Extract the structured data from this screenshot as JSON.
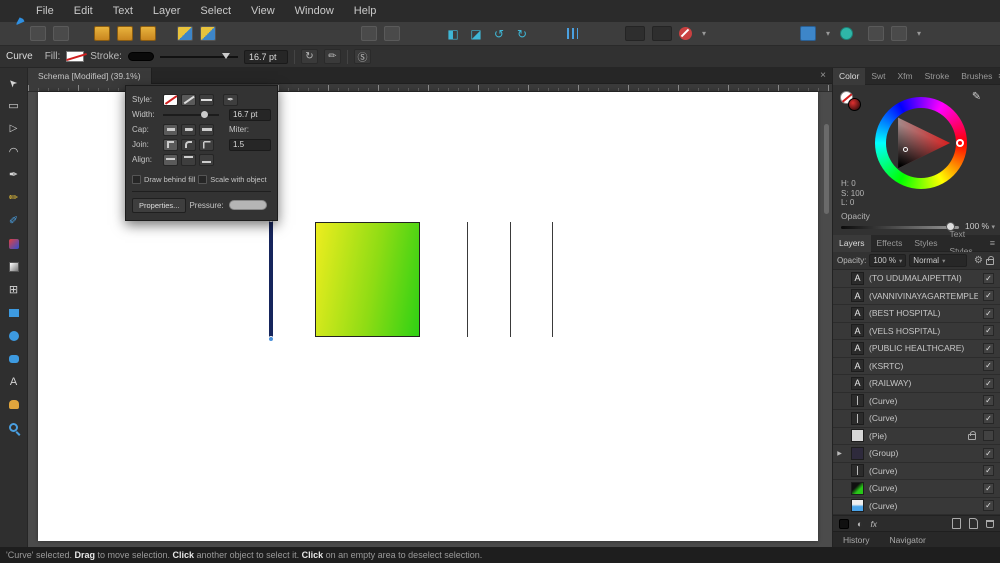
{
  "colors": {
    "accent_blue": "#2f8fe0",
    "canvas_bg": "#4b4b4b",
    "panel_bg": "#323232",
    "gradient_rect_start": "#eded1f",
    "gradient_rect_end": "#2fd114",
    "navy_line": "#16255c",
    "selection_handle": "#4a90d9",
    "snap_off_red": "#c94040"
  },
  "menu": {
    "items": [
      "File",
      "Edit",
      "Text",
      "Layer",
      "Select",
      "View",
      "Window",
      "Help"
    ]
  },
  "context_toolbar": {
    "tool_label": "Curve",
    "fill_label": "Fill:",
    "stroke_label": "Stroke:",
    "stroke_width": "16.7 pt"
  },
  "document": {
    "tab_title": "Schema [Modified] (39.1%)"
  },
  "stroke_popup": {
    "style_label": "Style:",
    "width_label": "Width:",
    "width_value": "16.7 pt",
    "cap_label": "Cap:",
    "miter_label": "Miter:",
    "join_label": "Join:",
    "miter_value": "1.5",
    "align_label": "Align:",
    "draw_behind_fill": "Draw behind fill",
    "scale_with_object": "Scale with object",
    "properties_button": "Properties...",
    "pressure_label": "Pressure:"
  },
  "color_panel": {
    "tabs": [
      "Color",
      "Swt",
      "Xfm",
      "Stroke",
      "Brushes"
    ],
    "h": "H: 0",
    "s": "S: 100",
    "l": "L: 0",
    "opacity_label": "Opacity",
    "opacity_value": "100 %"
  },
  "layers_panel": {
    "tabs": [
      "Layers",
      "Effects",
      "Styles",
      "Text Styles"
    ],
    "opacity_label": "Opacity:",
    "opacity_value": "100 %",
    "blend_mode": "Normal",
    "fx_label": "fx",
    "layers": [
      {
        "label": "(TO UDUMALAIPETTAI)",
        "thumb": "A"
      },
      {
        "label": "(VANNIVINAYAGARTEMPLE)",
        "thumb": "A"
      },
      {
        "label": "(BEST HOSPITAL)",
        "thumb": "A"
      },
      {
        "label": "(VELS HOSPITAL)",
        "thumb": "A"
      },
      {
        "label": "(PUBLIC HEALTHCARE)",
        "thumb": "A"
      },
      {
        "label": "(KSRTC)",
        "thumb": "A"
      },
      {
        "label": "(RAILWAY)",
        "thumb": "A"
      },
      {
        "label": "(Curve)",
        "thumb": ""
      },
      {
        "label": "(Curve)",
        "thumb": ""
      },
      {
        "label": "(Pie)",
        "thumb": ""
      },
      {
        "label": "(Group)",
        "thumb": ""
      },
      {
        "label": "(Curve)",
        "thumb": ""
      },
      {
        "label": "(Curve)",
        "thumb": ""
      },
      {
        "label": "(Curve)",
        "thumb": ""
      }
    ]
  },
  "bottom_tabs": {
    "history": "History",
    "navigator": "Navigator"
  },
  "status_bar": {
    "part1": "'Curve' selected. ",
    "bold1": "Drag",
    "part2": " to move selection. ",
    "bold2": "Click",
    "part3": " another object to select it. ",
    "bold3": "Click",
    "part4": " on an empty area to deselect selection."
  },
  "icons": {
    "close": "×",
    "chevron": "▾",
    "check": "✓",
    "expand": "▶",
    "gear": "⚙",
    "menu": "≡",
    "pen": "✒",
    "pencil": "✏",
    "brush": "✐",
    "eyedropper": "✐",
    "cursor": "➤",
    "artboard": "▭",
    "node": "▷",
    "corner": "◠",
    "crop": "⊞",
    "text_tool": "A",
    "adjustment": "◐",
    "flip_h": "◧",
    "flip_v": "◪",
    "rotate_ccw": "↺",
    "rotate_cw": "↻",
    "sync": "Ⓢ"
  }
}
